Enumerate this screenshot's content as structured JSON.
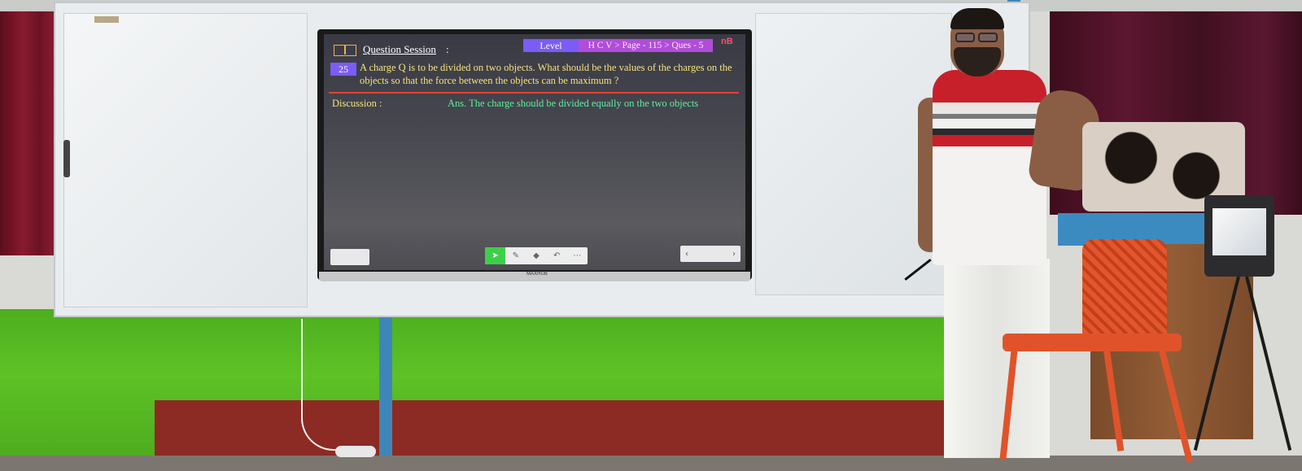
{
  "screen": {
    "header": {
      "title": "Question Session",
      "title_suffix": ":",
      "level_label": "Level",
      "path": "H C V > Page - 115 > Ques - 5",
      "corner_mark": "nB"
    },
    "question": {
      "number": "25",
      "text": "A charge Q is to be divided on two objects. What should be the values of the charges on the objects so that the force between the objects can be maximum ?"
    },
    "discussion": {
      "label": "Discussion :",
      "answer": "Ans. The charge should be divided equally on the two objects"
    },
    "toolbar": {
      "tools": [
        "select-icon",
        "pen-icon",
        "eraser-icon",
        "undo-icon",
        "more-icon"
      ]
    },
    "pager": {
      "prev": "‹",
      "next": "›"
    },
    "brand": "MAXHUB"
  },
  "colors": {
    "accent_purple": "#7b5cf5",
    "path_magenta": "#b04dd9",
    "question_yellow": "#f3e37a",
    "answer_green": "#5ef09b",
    "divider_red": "#e0452f"
  }
}
